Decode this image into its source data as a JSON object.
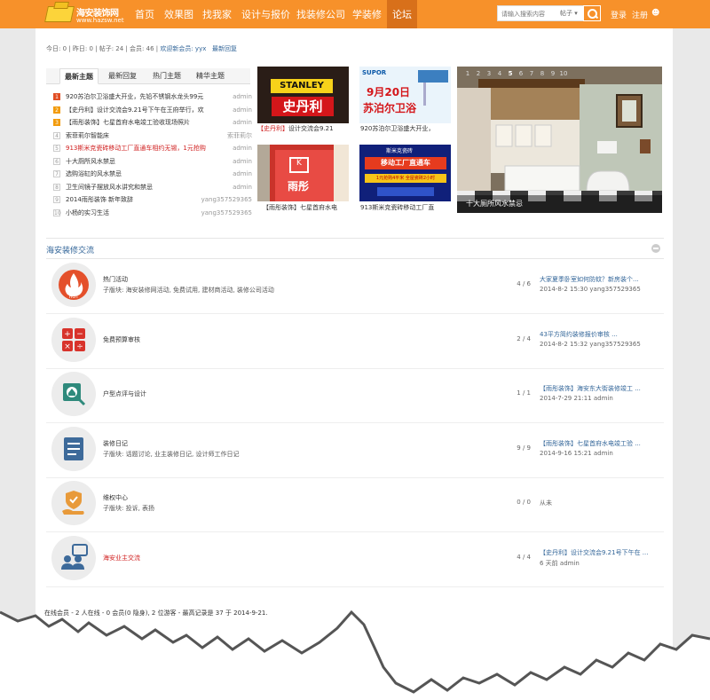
{
  "site": {
    "logo_name": "海安装饰网",
    "logo_url": "www.hazsw.net"
  },
  "nav": [
    {
      "label": "首页"
    },
    {
      "label": "效果图"
    },
    {
      "label": "找我家"
    },
    {
      "label": "设计与报价"
    },
    {
      "label": "找装修公司"
    },
    {
      "label": "学装修"
    },
    {
      "label": "论坛",
      "active": true
    }
  ],
  "search": {
    "placeholder": "请输入搜索内容",
    "type": "帖子"
  },
  "account": {
    "login": "登录",
    "register": "注册"
  },
  "stats": {
    "today": "今日: 0",
    "yesterday": "昨日: 0",
    "posts": "帖子: 24",
    "members": "会员: 46",
    "welcome": "欢迎新会员: yyx",
    "latest": "最新回复"
  },
  "tabs": [
    "最新主题",
    "最新回复",
    "热门主题",
    "精华主题"
  ],
  "threads": [
    {
      "n": "1",
      "title": "920苏泊尔卫浴盛大开业，先铅不锈钢水龙头99元",
      "author": "admin",
      "style": "hot"
    },
    {
      "n": "2",
      "title": "【史丹利】设计交流会9.21号下午在王府举行，欢",
      "author": "admin",
      "style": "hot"
    },
    {
      "n": "3",
      "title": "【雨彤装饰】七星首府水电竣工验收现场照片",
      "author": "admin",
      "style": "hot"
    },
    {
      "n": "4",
      "title": "索菲莉尔智能床",
      "author": "索菲莉尔",
      "style": ""
    },
    {
      "n": "5",
      "title": "913斯米克瓷砖移动工厂直通车相约无锡，1元抢购",
      "author": "admin",
      "style": "red"
    },
    {
      "n": "6",
      "title": "十大厕所风水禁忌",
      "author": "admin",
      "style": ""
    },
    {
      "n": "7",
      "title": "选购浴缸的风水禁忌",
      "author": "admin",
      "style": ""
    },
    {
      "n": "8",
      "title": "卫生间镜子摆放风水讲究和禁忌",
      "author": "admin",
      "style": ""
    },
    {
      "n": "9",
      "title": "2014雨彤装饰 新年致辞",
      "author": "yang357529365",
      "style": ""
    },
    {
      "n": "10",
      "title": "小杨的实习生活",
      "author": "yang357529365",
      "style": ""
    }
  ],
  "pics": [
    {
      "brand": "STANLEY",
      "cn": "史丹利",
      "caption_tag": "【史丹利】",
      "caption": "设计交流会9.21"
    },
    {
      "brand": "SUPOR",
      "date": "9月20日",
      "cn": "苏泊尔卫浴",
      "caption": "920苏泊尔卫浴盛大开业，"
    },
    {
      "cn": "雨彤",
      "caption": "【雨彤装饰】七星首府水电"
    },
    {
      "brand": "斯米克瓷砖",
      "banner": "移动工厂直通车",
      "sub": "1元抢购4平米 全屋瓷砖2小时",
      "caption": "913斯米克瓷砖移动工厂直"
    }
  ],
  "slider": {
    "numbers": [
      "1",
      "2",
      "3",
      "4",
      "5",
      "6",
      "7",
      "8",
      "9",
      "10"
    ],
    "current": "5",
    "caption": "十大厕所风水禁忌"
  },
  "section": {
    "title": "海安装修交流"
  },
  "forums": [
    {
      "icon": "hot-flame-icon",
      "name": "热门活动",
      "sub": "子版块: 海安装修网活动, 免费试用, 建材商活动, 装修公司活动",
      "count": "4 / 6",
      "last_title": "大家夏季卧室如何防蚊？新房装个...",
      "last_meta": "2014-8-2 15:30 yang357529365"
    },
    {
      "icon": "calculator-icon",
      "name": "免费预算审核",
      "sub": "",
      "count": "2 / 4",
      "last_title": "43平方简约装修报价审核 ...",
      "last_meta": "2014-8-2 15:32 yang357529365"
    },
    {
      "icon": "floorplan-magnifier-icon",
      "name": "户型点评与设计",
      "sub": "",
      "count": "1 / 1",
      "last_title": "【雨彤装饰】海安东大街装修竣工 ...",
      "last_meta": "2014-7-29 21:11 admin"
    },
    {
      "icon": "diary-list-icon",
      "name": "装修日记",
      "sub": "子版块: 话题讨论, 业主装修日记, 设计师工作日记",
      "count": "9 / 9",
      "last_title": "【雨彤装饰】七星首府水电竣工验 ...",
      "last_meta": "2014-9-16 15:21 admin"
    },
    {
      "icon": "shield-hand-icon",
      "name": "维权中心",
      "sub": "子版块: 投诉, 表扬",
      "count": "0 / 0",
      "last_title": "从未",
      "last_meta": ""
    },
    {
      "icon": "users-chat-icon",
      "name": "海安业主交流",
      "sub": "",
      "count": "4 / 4",
      "last_title": "【史丹利】设计交流会9.21号下午在 ...",
      "last_meta": "6 天前 admin",
      "red": true
    }
  ],
  "online": "在线会员 - 2 人在线 - 0 会员(0 隐身), 2 位游客 - 最高记录是 37 于 2014-9-21.",
  "colors": {
    "nav": "#f7912a",
    "nav_active": "#d8701a",
    "link": "#336699",
    "red": "#d02020"
  }
}
